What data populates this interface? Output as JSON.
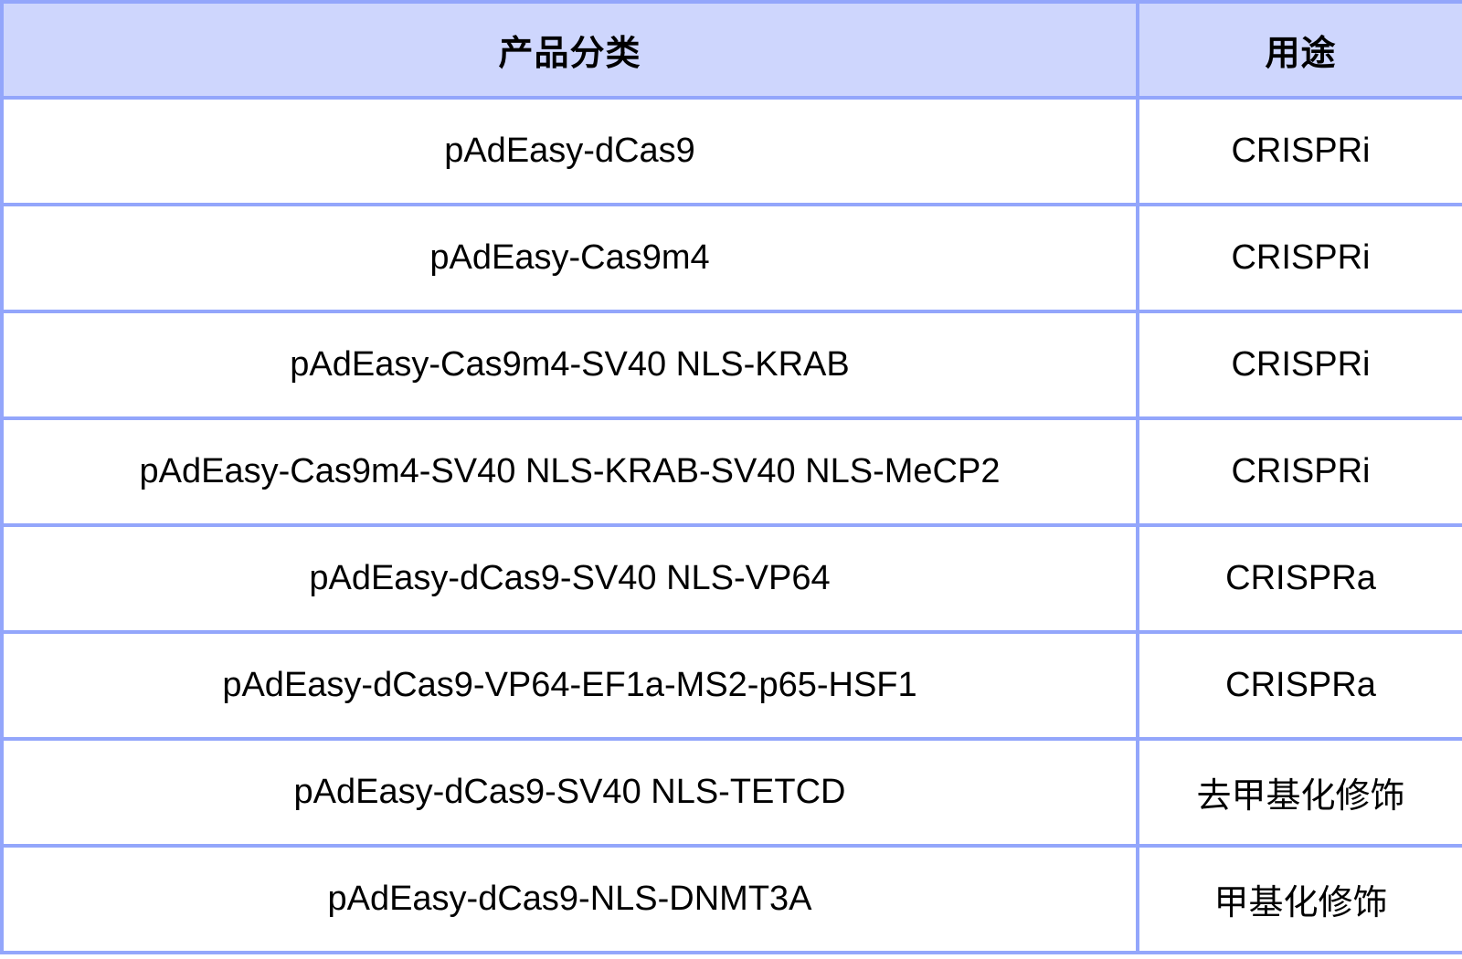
{
  "table": {
    "columns": [
      {
        "key": "category",
        "header": "产品分类"
      },
      {
        "key": "usage",
        "header": "用途"
      }
    ],
    "rows": [
      {
        "category": "pAdEasy-dCas9",
        "usage": "CRISPRi"
      },
      {
        "category": "pAdEasy-Cas9m4",
        "usage": "CRISPRi"
      },
      {
        "category": "pAdEasy-Cas9m4-SV40 NLS-KRAB",
        "usage": "CRISPRi"
      },
      {
        "category": "pAdEasy-Cas9m4-SV40 NLS-KRAB-SV40 NLS-MeCP2",
        "usage": "CRISPRi"
      },
      {
        "category": "pAdEasy-dCas9-SV40 NLS-VP64",
        "usage": "CRISPRa"
      },
      {
        "category": "pAdEasy-dCas9-VP64-EF1a-MS2-p65-HSF1",
        "usage": "CRISPRa"
      },
      {
        "category": "pAdEasy-dCas9-SV40 NLS-TETCD",
        "usage": "去甲基化修饰"
      },
      {
        "category": "pAdEasy-dCas9-NLS-DNMT3A",
        "usage": "甲基化修饰"
      }
    ]
  },
  "colors": {
    "header_background": "#ced6fd",
    "border": "#93a6fb",
    "cell_background": "#ffffff",
    "text": "#000000"
  }
}
